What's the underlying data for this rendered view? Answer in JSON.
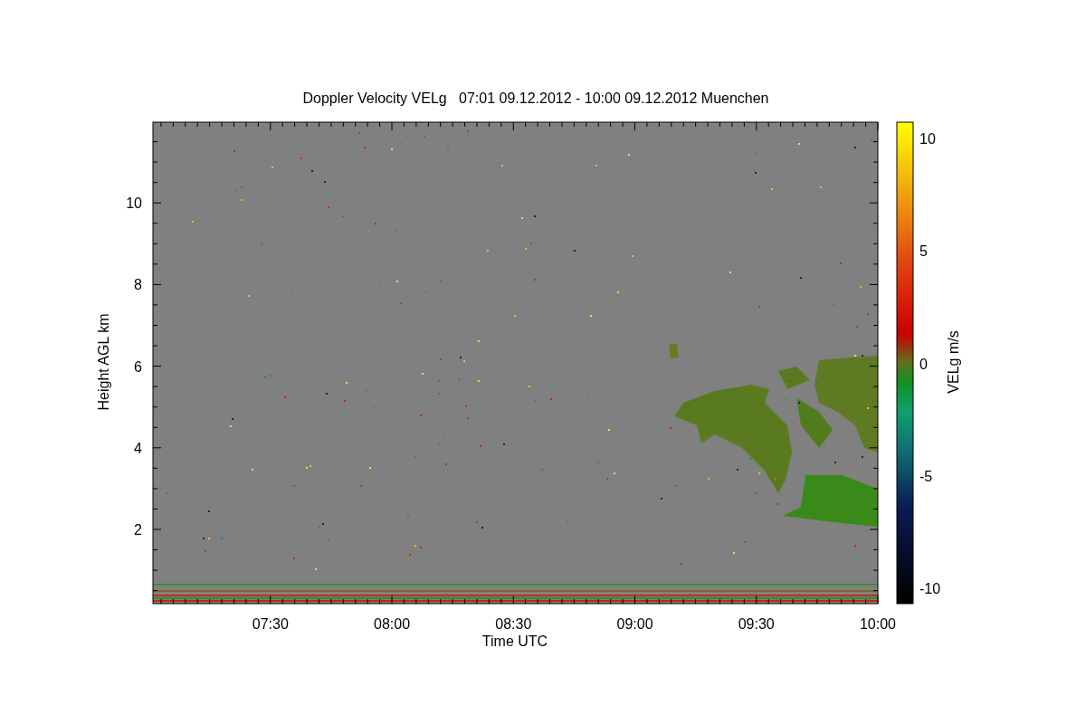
{
  "title": "Doppler Velocity VELg   07:01 09.12.2012 - 10:00 09.12.2012 Muenchen",
  "xlabel": "Time UTC",
  "ylabel": "Height AGL km",
  "xtick_labels": [
    "07:30",
    "08:00",
    "08:30",
    "09:00",
    "09:30",
    "10:00"
  ],
  "ytick_labels": [
    "10",
    "8",
    "6",
    "4",
    "2"
  ],
  "colorbar": {
    "label": "VELg m/s",
    "tick_labels": [
      "10",
      "5",
      "0",
      "-5",
      "-10"
    ]
  }
}
